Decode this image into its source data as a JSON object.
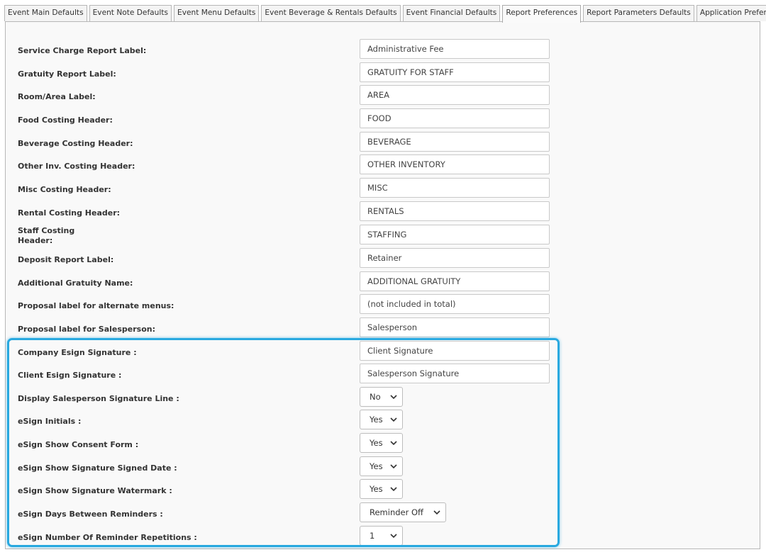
{
  "tabs": [
    {
      "label": "Event Main Defaults",
      "active": false
    },
    {
      "label": "Event Note Defaults",
      "active": false
    },
    {
      "label": "Event Menu Defaults",
      "active": false
    },
    {
      "label": "Event Beverage & Rentals Defaults",
      "active": false
    },
    {
      "label": "Event Financial Defaults",
      "active": false
    },
    {
      "label": "Report Preferences",
      "active": true
    },
    {
      "label": "Report Parameters Defaults",
      "active": false
    },
    {
      "label": "Application Preferences",
      "active": false
    }
  ],
  "fields": [
    {
      "label": "Service Charge Report Label:",
      "type": "text",
      "value": "Administrative Fee"
    },
    {
      "label": "Gratuity Report Label:",
      "type": "text",
      "value": "GRATUITY FOR STAFF"
    },
    {
      "label": "Room/Area Label:",
      "type": "text",
      "value": "AREA"
    },
    {
      "label": "Food Costing Header:",
      "type": "text",
      "value": "FOOD"
    },
    {
      "label": "Beverage Costing Header:",
      "type": "text",
      "value": "BEVERAGE"
    },
    {
      "label": "Other Inv. Costing Header:",
      "type": "text",
      "value": "OTHER INVENTORY"
    },
    {
      "label": "Misc Costing Header:",
      "type": "text",
      "value": "MISC"
    },
    {
      "label": "Rental Costing Header:",
      "type": "text",
      "value": "RENTALS"
    },
    {
      "label": "Staff Costing Header:",
      "type": "text",
      "value": "STAFFING"
    },
    {
      "label": "Deposit Report Label:",
      "type": "text",
      "value": "Retainer"
    },
    {
      "label": "Additional Gratuity Name:",
      "type": "text",
      "value": "ADDITIONAL GRATUITY"
    },
    {
      "label": "Proposal label for alternate menus:",
      "type": "text",
      "value": "(not included in total)"
    },
    {
      "label": "Proposal label for Salesperson:",
      "type": "text",
      "value": "Salesperson"
    },
    {
      "label": "Company Esign Signature :",
      "type": "text",
      "value": "Client Signature"
    },
    {
      "label": "Client Esign Signature :",
      "type": "text",
      "value": "Salesperson Signature"
    },
    {
      "label": "Display Salesperson Signature Line :",
      "type": "select",
      "value": "No"
    },
    {
      "label": "eSign Initials :",
      "type": "select",
      "value": "Yes"
    },
    {
      "label": "eSign Show Consent Form :",
      "type": "select",
      "value": "Yes"
    },
    {
      "label": "eSign Show Signature Signed Date :",
      "type": "select",
      "value": "Yes"
    },
    {
      "label": "eSign Show Signature Watermark :",
      "type": "select",
      "value": "Yes"
    },
    {
      "label": "eSign Days Between Reminders :",
      "type": "select",
      "value": "Reminder Off"
    },
    {
      "label": "eSign Number Of Reminder Repetitions :",
      "type": "select",
      "value": "1"
    }
  ],
  "colors": {
    "highlight": "#29a9e0",
    "panel_background": "#f9f9f9",
    "border": "#b7b7b7"
  },
  "icons": {
    "select_arrow": "chevron-down-icon"
  }
}
